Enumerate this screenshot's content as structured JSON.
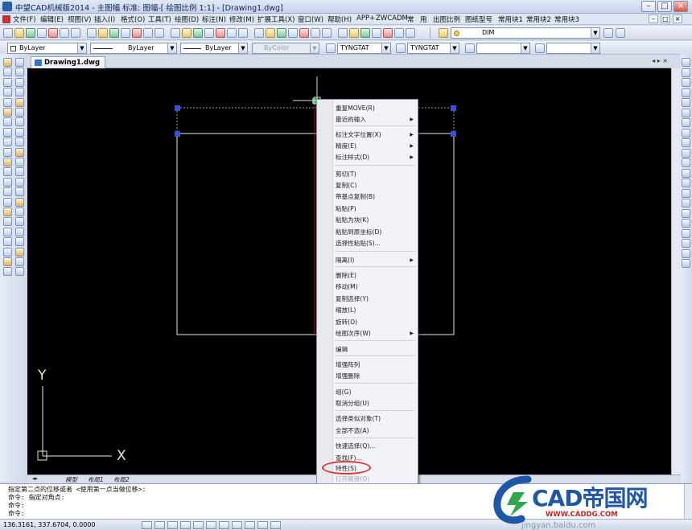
{
  "window": {
    "title": "中望CAD机械版2014 - 主图幅  标准: 图幅-[ 绘图比例 1:1] - [Drawing1.dwg]"
  },
  "menubar": {
    "items": [
      "文件(F)",
      "编辑(E)",
      "视图(V)",
      "插入(I)",
      "格式(O)",
      "工具(T)",
      "绘图(D)",
      "标注(N)",
      "修改(M)",
      "扩展工具(X)",
      "窗口(W)",
      "帮助(H)",
      "APP+",
      "ZWCADM",
      "常",
      "用",
      "出图比例",
      "图纸型号",
      "常用块1",
      "常用块2",
      "常用块3"
    ]
  },
  "toolbar": {
    "layer_combo": "DIM",
    "color_combo": "ByLayer",
    "linetype_combo": "ByLayer",
    "lineweight_combo": "ByLayer",
    "plotstyle_combo": "ByColor",
    "textstyle_combo": "TYNGTAT",
    "dimstyle_combo": "TYNGTAT"
  },
  "document": {
    "tab_label": "Drawing1.dwg",
    "tab_scroll": "◂ ▸ ×"
  },
  "ucs": {
    "x_label": "X",
    "y_label": "Y"
  },
  "layout_tabs": [
    "模型",
    "布局1",
    "布局2"
  ],
  "context_menu": {
    "items": [
      {
        "label": "重复MOVE(R)",
        "submenu": false,
        "enabled": true
      },
      {
        "label": "最近的输入",
        "submenu": true,
        "enabled": true
      },
      {
        "label": "标注文字位置(X)",
        "submenu": true,
        "enabled": true
      },
      {
        "label": "精度(E)",
        "submenu": true,
        "enabled": true
      },
      {
        "label": "标注样式(D)",
        "submenu": true,
        "enabled": true
      },
      {
        "label": "剪切(T)",
        "submenu": false,
        "enabled": true
      },
      {
        "label": "复制(C)",
        "submenu": false,
        "enabled": true
      },
      {
        "label": "带基点复制(B)",
        "submenu": false,
        "enabled": true
      },
      {
        "label": "粘贴(P)",
        "submenu": false,
        "enabled": true
      },
      {
        "label": "粘贴为块(K)",
        "submenu": false,
        "enabled": true
      },
      {
        "label": "粘贴到原坐标(D)",
        "submenu": false,
        "enabled": true
      },
      {
        "label": "选择性粘贴(S)...",
        "submenu": false,
        "enabled": true
      },
      {
        "label": "隔离(I)",
        "submenu": true,
        "enabled": true
      },
      {
        "label": "删除(E)",
        "submenu": false,
        "enabled": true
      },
      {
        "label": "移动(M)",
        "submenu": false,
        "enabled": true
      },
      {
        "label": "复制选择(Y)",
        "submenu": false,
        "enabled": true
      },
      {
        "label": "缩放(L)",
        "submenu": false,
        "enabled": true
      },
      {
        "label": "旋转(O)",
        "submenu": false,
        "enabled": true
      },
      {
        "label": "绘图次序(W)",
        "submenu": true,
        "enabled": true
      },
      {
        "label": "编辑",
        "submenu": false,
        "enabled": true
      },
      {
        "label": "增强阵列",
        "submenu": false,
        "enabled": true
      },
      {
        "label": "增强删除",
        "submenu": false,
        "enabled": true
      },
      {
        "label": "组(G)",
        "submenu": false,
        "enabled": true
      },
      {
        "label": "取消分组(U)",
        "submenu": false,
        "enabled": true
      },
      {
        "label": "选择类似对象(T)",
        "submenu": false,
        "enabled": true
      },
      {
        "label": "全部不选(A)",
        "submenu": false,
        "enabled": true
      },
      {
        "label": "快速选择(Q)...",
        "submenu": false,
        "enabled": true
      },
      {
        "label": "查找(F)...",
        "submenu": false,
        "enabled": true
      },
      {
        "label": "特性(S)",
        "submenu": false,
        "enabled": true
      },
      {
        "label": "打开链接(O)",
        "submenu": false,
        "enabled": false
      }
    ]
  },
  "command": {
    "line1": "指定第二点的位移或者 <使用第一点当做位移>:",
    "line2": "命令: 指定对角点:",
    "line3": "命令:",
    "line4": "命令:"
  },
  "status": {
    "coords": "136.3161,  337.6704,  0.0000"
  },
  "watermark": {
    "brand": "CAD帝国网",
    "url": "WWW.CADDG.COM",
    "baidu": "jingyan.baidu.com"
  },
  "colors": {
    "canvas": "#000000",
    "grip": "#3b4fd9",
    "highlight": "#d83a3a",
    "brand": "#1f56a6"
  }
}
